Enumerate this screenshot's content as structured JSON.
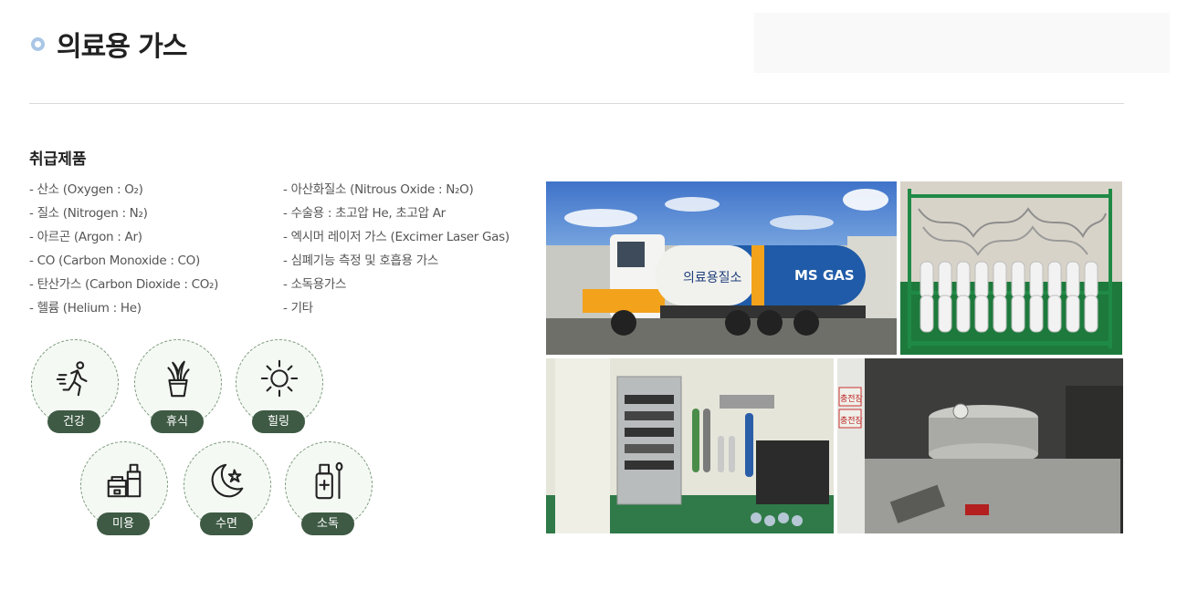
{
  "page": {
    "title": "의료용 가스"
  },
  "products": {
    "heading": "취급제품",
    "left": [
      "- 산소 (Oxygen : O₂)",
      "- 질소 (Nitrogen : N₂)",
      "- 아르곤 (Argon : Ar)",
      "- CO (Carbon Monoxide : CO)",
      "- 탄산가스 (Carbon Dioxide : CO₂)",
      "- 헬륨 (Helium : He)"
    ],
    "right": [
      "- 아산화질소 (Nitrous Oxide : N₂O)",
      "- 수술용 : 초고압 He, 초고압 Ar",
      "- 엑시머 레이저 가스 (Excimer Laser Gas)",
      "- 심폐기능 측정 및 호흡용 가스",
      "- 소독용가스",
      "- 기타"
    ]
  },
  "uses": [
    {
      "label": "건강",
      "icon": "running-person-icon"
    },
    {
      "label": "휴식",
      "icon": "potted-plant-icon"
    },
    {
      "label": "힐링",
      "icon": "sun-icon"
    },
    {
      "label": "미용",
      "icon": "cosmetics-icon"
    },
    {
      "label": "수면",
      "icon": "moon-star-icon"
    },
    {
      "label": "소독",
      "icon": "disinfectant-bottle-icon"
    }
  ],
  "photos": {
    "truck_tank_label": "의료용질소",
    "truck_brand": "MS GAS",
    "room_sign_1": "충전장",
    "room_sign_2": "충전장"
  },
  "colors": {
    "pill": "#3e5a44",
    "title_dot": "#a9c6e6",
    "truck_tank": "#1f5ba8",
    "truck_stripe": "#f3a21c"
  }
}
